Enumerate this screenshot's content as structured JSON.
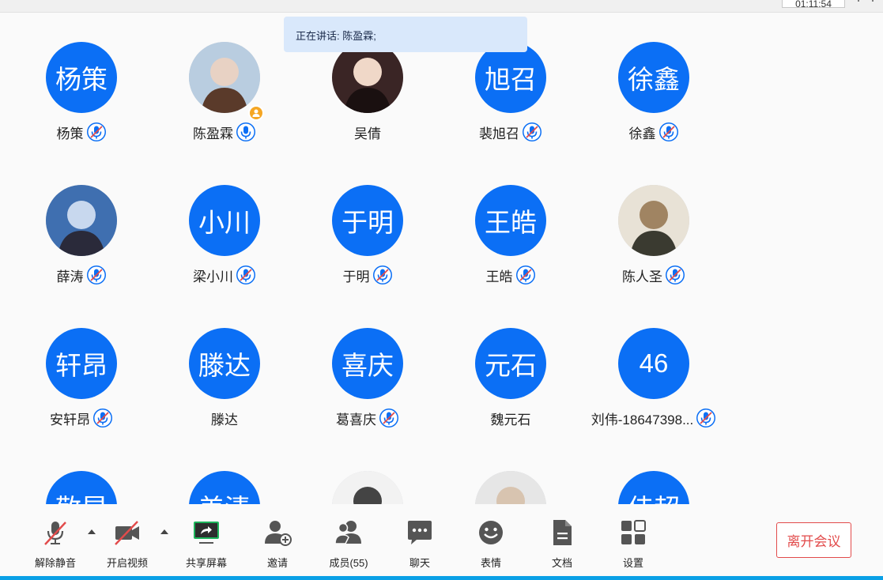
{
  "top": {
    "timer": "01:11:54"
  },
  "speaking": {
    "text": "正在讲话: 陈盈霖;"
  },
  "participants": [
    {
      "avatar_text": "杨策",
      "name": "杨策",
      "mic": "muted",
      "photo": false
    },
    {
      "avatar_text": "",
      "name": "陈盈霖",
      "mic": "on",
      "photo": true,
      "host": true
    },
    {
      "avatar_text": "",
      "name": "吴倩",
      "mic": "none",
      "photo": true
    },
    {
      "avatar_text": "旭召",
      "name": "裴旭召",
      "mic": "muted",
      "photo": false
    },
    {
      "avatar_text": "徐鑫",
      "name": "徐鑫",
      "mic": "muted",
      "photo": false
    },
    {
      "avatar_text": "",
      "name": "薛涛",
      "mic": "muted",
      "photo": true
    },
    {
      "avatar_text": "小川",
      "name": "梁小川",
      "mic": "muted",
      "photo": false
    },
    {
      "avatar_text": "于明",
      "name": "于明",
      "mic": "muted",
      "photo": false
    },
    {
      "avatar_text": "王皓",
      "name": "王皓",
      "mic": "muted",
      "photo": false
    },
    {
      "avatar_text": "",
      "name": "陈人圣",
      "mic": "muted",
      "photo": true
    },
    {
      "avatar_text": "轩昂",
      "name": "安轩昂",
      "mic": "muted",
      "photo": false
    },
    {
      "avatar_text": "滕达",
      "name": "滕达",
      "mic": "none",
      "photo": false
    },
    {
      "avatar_text": "喜庆",
      "name": "葛喜庆",
      "mic": "muted",
      "photo": false
    },
    {
      "avatar_text": "元石",
      "name": "魏元石",
      "mic": "none",
      "photo": false
    },
    {
      "avatar_text": "46",
      "name": "刘伟-18647398...",
      "mic": "muted",
      "photo": false
    },
    {
      "avatar_text": "敬昆",
      "name": "",
      "mic": "none",
      "photo": false
    },
    {
      "avatar_text": "美清",
      "name": "",
      "mic": "none",
      "photo": false
    },
    {
      "avatar_text": "",
      "name": "",
      "mic": "none",
      "photo": true
    },
    {
      "avatar_text": "",
      "name": "",
      "mic": "none",
      "photo": true
    },
    {
      "avatar_text": "侍超",
      "name": "",
      "mic": "none",
      "photo": false
    }
  ],
  "toolbar": {
    "unmute": "解除静音",
    "start_video": "开启视频",
    "share_screen": "共享屏幕",
    "invite": "邀请",
    "members": "成员(55)",
    "chat": "聊天",
    "emoji": "表情",
    "docs": "文档",
    "settings": "设置",
    "leave": "离开会议"
  },
  "colors": {
    "accent": "#0b6ff5",
    "leave": "#e24b4b",
    "share_green": "#1db45a"
  }
}
